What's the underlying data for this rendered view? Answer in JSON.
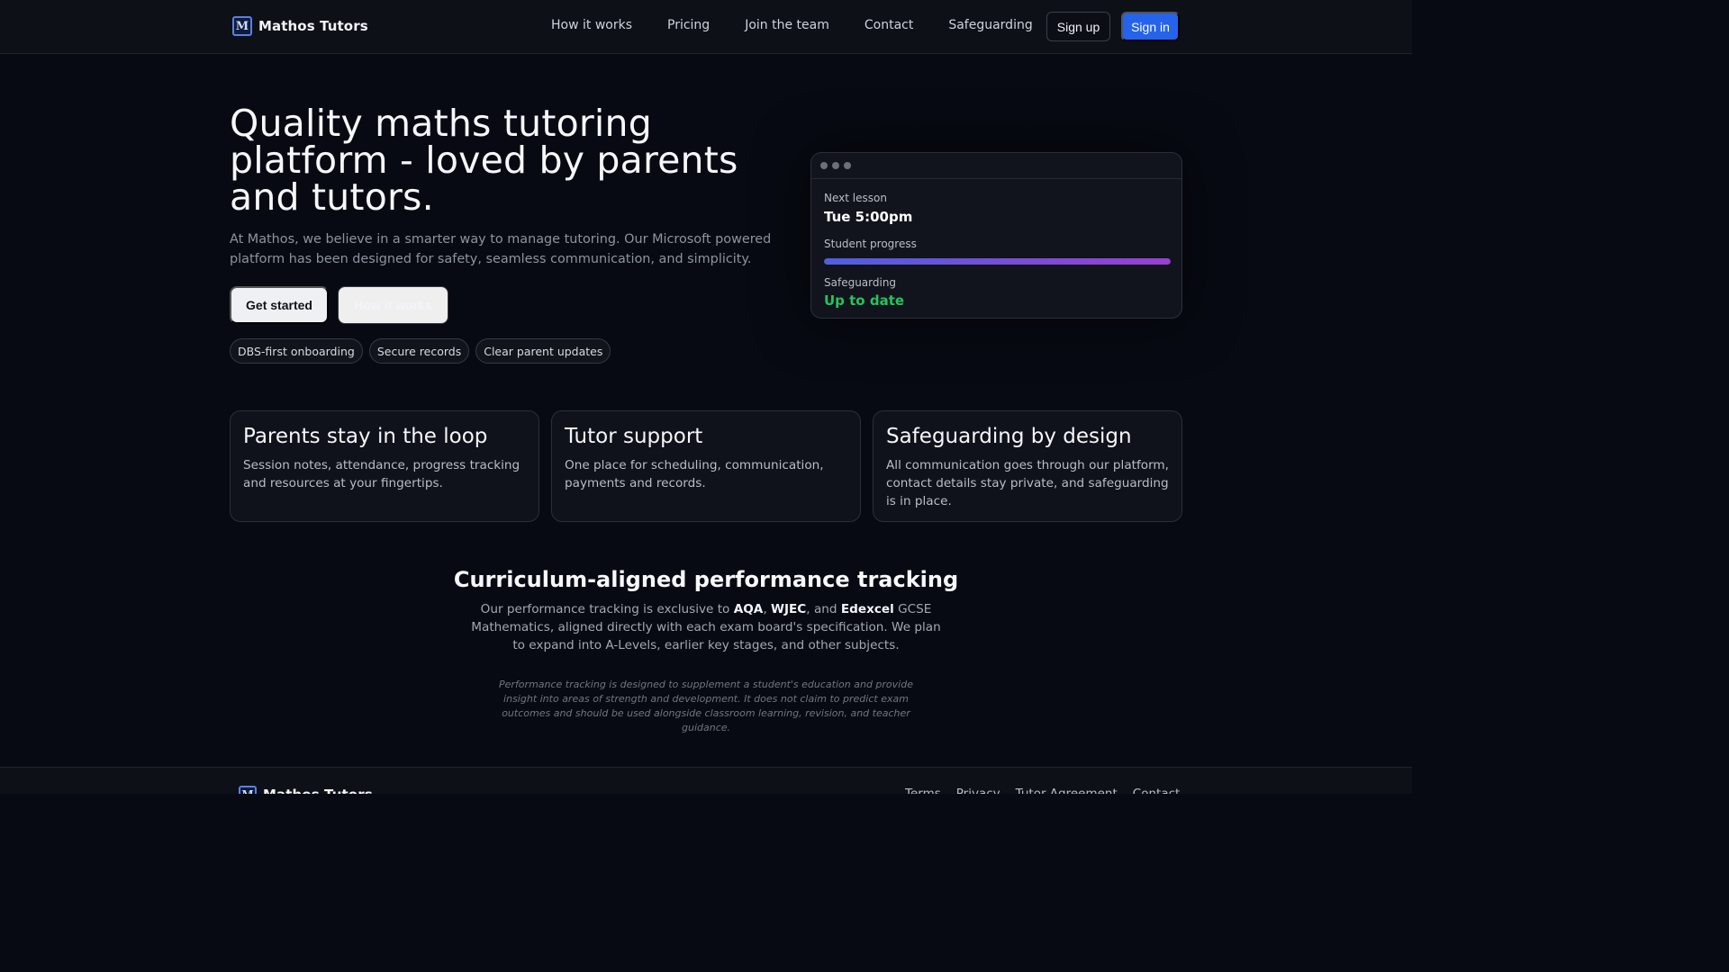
{
  "header": {
    "brand_logo_letter": "M",
    "brand_name": "Mathos Tutors",
    "nav": [
      "How it works",
      "Pricing",
      "Join the team",
      "Contact",
      "Safeguarding"
    ],
    "signup_label": "Sign up",
    "signin_label": "Sign in",
    "signin_color": "#2563eb"
  },
  "hero": {
    "title": "Quality maths tutoring platform - loved by parents and tutors.",
    "subtitle": "At Mathos, we believe in a smarter way to manage tutoring. Our Microsoft powered platform has been designed for safety, seamless communication, and simplicity.",
    "primary_cta": "Get started",
    "secondary_cta": "How it works",
    "pills": [
      "DBS-first onboarding",
      "Secure records",
      "Clear parent updates"
    ]
  },
  "preview_card": {
    "next_lesson_label": "Next lesson",
    "next_lesson_value": "Tue 5:00pm",
    "progress_label": "Student progress",
    "progress_percent": 100,
    "safeguarding_label": "Safeguarding",
    "safeguarding_value": "Up to date",
    "status_color": "#22c55e"
  },
  "features": [
    {
      "title": "Parents stay in the loop",
      "text": "Session notes, attendance, progress tracking and resources at your fingertips."
    },
    {
      "title": "Tutor support",
      "text": "One place for scheduling, communication, payments and records."
    },
    {
      "title": "Safeguarding by design",
      "text": "All communication goes through our platform, contact details stay private, and safeguarding is in place."
    }
  ],
  "tracking": {
    "title": "Curriculum-aligned performance tracking",
    "text_start": "Our performance tracking is exclusive to ",
    "board_1": "AQA",
    "sep_1": ", ",
    "board_2": "WJEC",
    "sep_2": ", and ",
    "board_3": "Edexcel",
    "text_end": " GCSE Mathematics, aligned directly with each exam board's specification. We plan to expand into A-Levels, earlier key stages, and other subjects.",
    "disclaimer": "Performance tracking is designed to supplement a student's education and provide insight into areas of strength and development. It does not claim to predict exam outcomes and should be used alongside classroom learning, revision, and teacher guidance."
  },
  "footer": {
    "brand_name": "Mathos Tutors",
    "links": [
      "Terms",
      "Privacy",
      "Tutor Agreement",
      "Contact"
    ]
  }
}
